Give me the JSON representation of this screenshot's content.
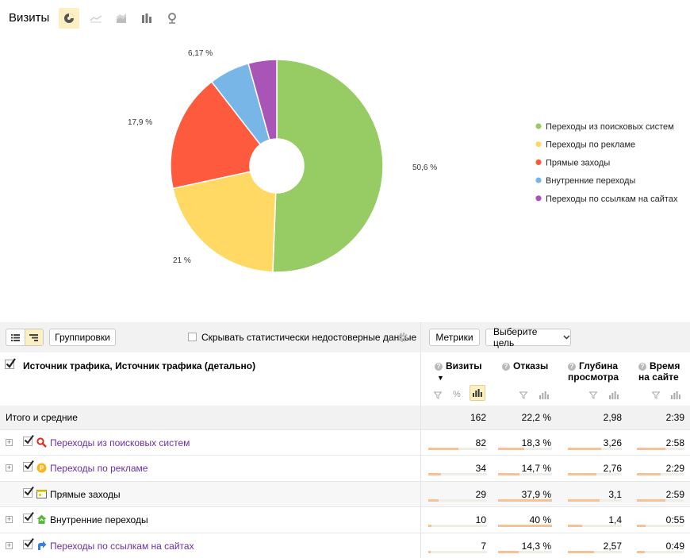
{
  "header": {
    "title": "Визиты",
    "view_buttons": [
      {
        "icon": "pie-chart-icon",
        "active": true
      },
      {
        "icon": "line-chart-icon",
        "active": false
      },
      {
        "icon": "area-chart-icon",
        "active": false
      },
      {
        "icon": "bar-chart-icon",
        "active": false
      },
      {
        "icon": "map-icon",
        "active": false
      }
    ]
  },
  "chart_data": {
    "type": "pie",
    "donut": true,
    "categories": [
      "Переходы из поисковых систем",
      "Переходы по рекламе",
      "Прямые заходы",
      "Внутренние переходы",
      "Переходы по ссылкам на сайтах"
    ],
    "values": [
      50.6,
      21,
      17.9,
      6.17,
      4.32
    ],
    "data_labels": [
      "50,6 %",
      "21 %",
      "17,9 %",
      "6,17 %",
      ""
    ],
    "colors": [
      "#97cc64",
      "#ffd963",
      "#fd5a3e",
      "#77b6e7",
      "#a955b8"
    ],
    "legend_position": "right"
  },
  "toolbar": {
    "groupings_label": "Группировки",
    "hide_unreliable_label": "Скрывать статистически недостоверные данные",
    "metrics_label": "Метрики",
    "goal_select_label": "Выберите цель"
  },
  "table": {
    "dimension_header": "Источник трафика, Источник трафика (детально)",
    "columns": [
      {
        "label": "Визиты",
        "sorted": true,
        "sort_marker": "▼"
      },
      {
        "label": "Отказы"
      },
      {
        "label_line1": "Глубина",
        "label_line2": "просмотра"
      },
      {
        "label_line1": "Время",
        "label_line2": "на сайте"
      }
    ],
    "total": {
      "label": "Итого и средние",
      "visits": "162",
      "bounce": "22,2 %",
      "depth": "2,98",
      "time": "2:39"
    },
    "rows": [
      {
        "label": "Переходы из поисковых систем",
        "visits": "82",
        "bounce": "18,3 %",
        "depth": "3,26",
        "time": "2:58",
        "icon": "search-engine-icon",
        "bars": [
          0.51,
          0.49,
          0.62,
          0.61
        ],
        "expandable": true,
        "link": true
      },
      {
        "label": "Переходы по рекламе",
        "visits": "34",
        "bounce": "14,7 %",
        "depth": "2,76",
        "time": "2:29",
        "icon": "ad-icon",
        "bars": [
          0.21,
          0.39,
          0.53,
          0.51
        ],
        "expandable": true,
        "link": true
      },
      {
        "label": "Прямые заходы",
        "visits": "29",
        "bounce": "37,9 %",
        "depth": "3,1",
        "time": "2:59",
        "icon": "direct-entry-icon",
        "bars": [
          0.18,
          1.0,
          0.59,
          0.61
        ],
        "expandable": false,
        "link": false
      },
      {
        "label": "Внутренние переходы",
        "visits": "10",
        "bounce": "40 %",
        "depth": "1,4",
        "time": "0:55",
        "icon": "internal-icon",
        "bars": [
          0.06,
          1.0,
          0.27,
          0.19
        ],
        "expandable": true,
        "link": false
      },
      {
        "label": "Переходы по ссылкам на сайтах",
        "visits": "7",
        "bounce": "14,3 %",
        "depth": "2,57",
        "time": "0:49",
        "icon": "link-icon",
        "bars": [
          0.04,
          0.38,
          0.49,
          0.17
        ],
        "expandable": true,
        "link": true
      }
    ]
  }
}
